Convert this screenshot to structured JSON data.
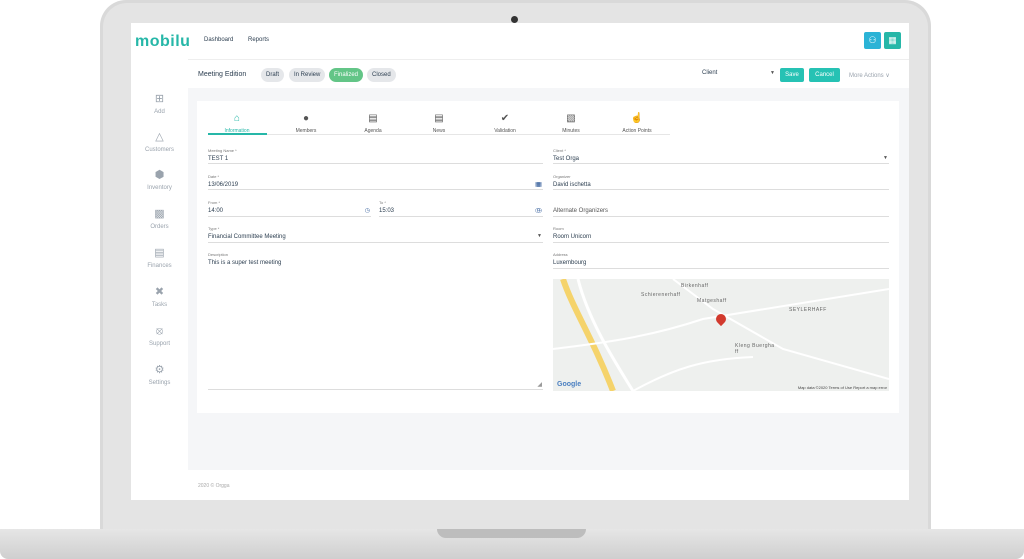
{
  "app": {
    "logo": "mobilu",
    "nav": [
      "Dashboard",
      "Reports"
    ]
  },
  "sidebar": {
    "items": [
      {
        "label": "Add",
        "icon": "plus-square-icon"
      },
      {
        "label": "Customers",
        "icon": "sitemap-icon"
      },
      {
        "label": "Inventory",
        "icon": "cube-icon"
      },
      {
        "label": "Orders",
        "icon": "cubes-icon"
      },
      {
        "label": "Finances",
        "icon": "bank-icon"
      },
      {
        "label": "Tasks",
        "icon": "tools-icon"
      },
      {
        "label": "Support",
        "icon": "lifebuoy-icon"
      },
      {
        "label": "Settings",
        "icon": "gear-icon"
      }
    ]
  },
  "toolbar": {
    "title": "Meeting Edition",
    "statuses": [
      "Draft",
      "In Review",
      "Finalized",
      "Closed"
    ],
    "active_status": "Finalized",
    "client_select": "Client",
    "save_label": "Save",
    "cancel_label": "Cancel",
    "more_label": "More Actions"
  },
  "tabs": [
    "Information",
    "Members",
    "Agenda",
    "News",
    "Validation",
    "Minutes",
    "Action Points"
  ],
  "form": {
    "meeting_name": {
      "label": "Meeting Name *",
      "value": "TEST 1"
    },
    "date": {
      "label": "Date *",
      "value": "13/06/2019"
    },
    "from": {
      "label": "From *",
      "value": "14:00"
    },
    "to": {
      "label": "To *",
      "value": "15:03"
    },
    "type": {
      "label": "Type *",
      "value": "Financial Committee Meeting"
    },
    "description": {
      "label": "Description",
      "value": "This is a super test meeting"
    },
    "client": {
      "label": "Client *",
      "value": "Test Orga"
    },
    "organizer": {
      "label": "Organizer",
      "value": "David ischetta"
    },
    "alternate_organizers": {
      "label": "",
      "value": "Alternate Organizers"
    },
    "room": {
      "label": "Room",
      "value": "Room Unicorn"
    },
    "address": {
      "label": "Address",
      "value": "Luxembourg"
    }
  },
  "map": {
    "labels": [
      "Birkenhaff",
      "Schierenerhaff",
      "Matgeshaff",
      "SEYLERHAFF",
      "Kleng Buergha ff",
      "Google"
    ],
    "attribution": "Map data ©2020   Terms of Use   Report a map error",
    "road_numbers": [
      "346",
      "123",
      "346",
      "40"
    ]
  },
  "footer": {
    "text": "2020 © Orgga"
  },
  "colors": {
    "accent": "#26b7a8",
    "finalized": "#63c587",
    "sidebar_text": "#9aa3ad"
  }
}
